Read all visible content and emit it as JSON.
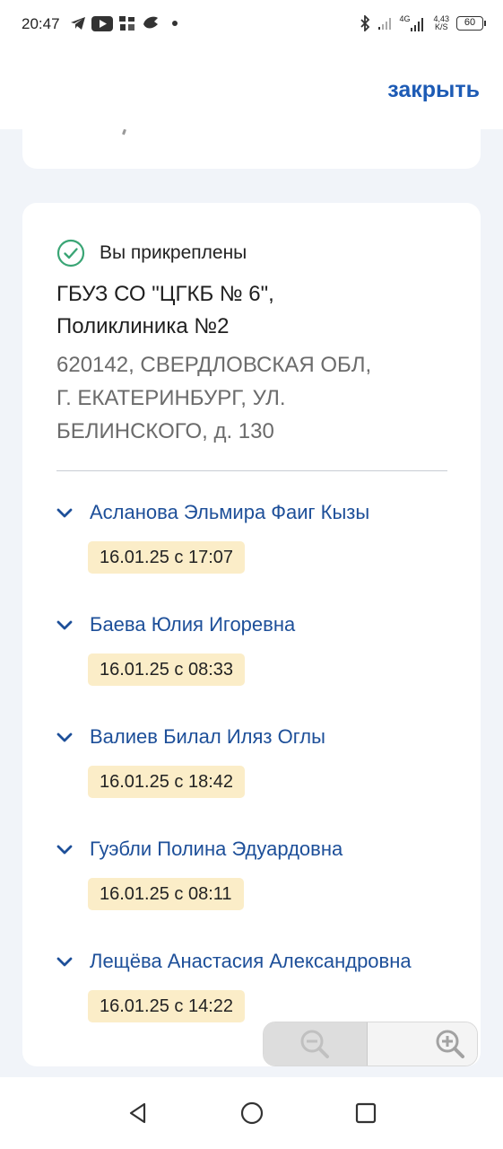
{
  "status_bar": {
    "time": "20:47",
    "net_speed_top": "4,43",
    "net_speed_bottom": "K/S",
    "network_type": "4G",
    "battery": "60"
  },
  "header": {
    "close_label": "закрыть"
  },
  "clinic": {
    "attached_label": "Вы прикреплены",
    "name_line1": "ГБУЗ СО \"ЦГКБ № 6\",",
    "name_line2": "Поликлиника №2",
    "address_line1": "620142, СВЕРДЛОВСКАЯ ОБЛ,",
    "address_line2": "Г. ЕКАТЕРИНБУРГ, УЛ.",
    "address_line3": "БЕЛИНСКОГО, д. 130"
  },
  "people": [
    {
      "name": "Асланова Эльмира Фаиг Кызы",
      "date": "16.01.25 с 17:07"
    },
    {
      "name": "Баева Юлия Игоревна",
      "date": "16.01.25 с 08:33"
    },
    {
      "name": "Валиев Билал Иляз Оглы",
      "date": "16.01.25 с 18:42"
    },
    {
      "name": "Гуэбли Полина Эдуардовна",
      "date": "16.01.25 с 08:11"
    },
    {
      "name": "Лещёва Анастасия Александровна",
      "date": "16.01.25 с 14:22"
    }
  ],
  "colors": {
    "accent": "#1d5bb5",
    "link_text": "#1d4f99",
    "badge_bg": "#fbedc8",
    "check_green": "#3aa575",
    "page_bg": "#f1f4f9"
  },
  "icons": {
    "attached": "check-circle-icon",
    "expand": "chevron-down-icon",
    "zoom_out": "zoom-out-icon",
    "zoom_in": "zoom-in-icon",
    "nav_back": "back-triangle-icon",
    "nav_home": "home-circle-icon",
    "nav_recents": "recents-square-icon"
  }
}
